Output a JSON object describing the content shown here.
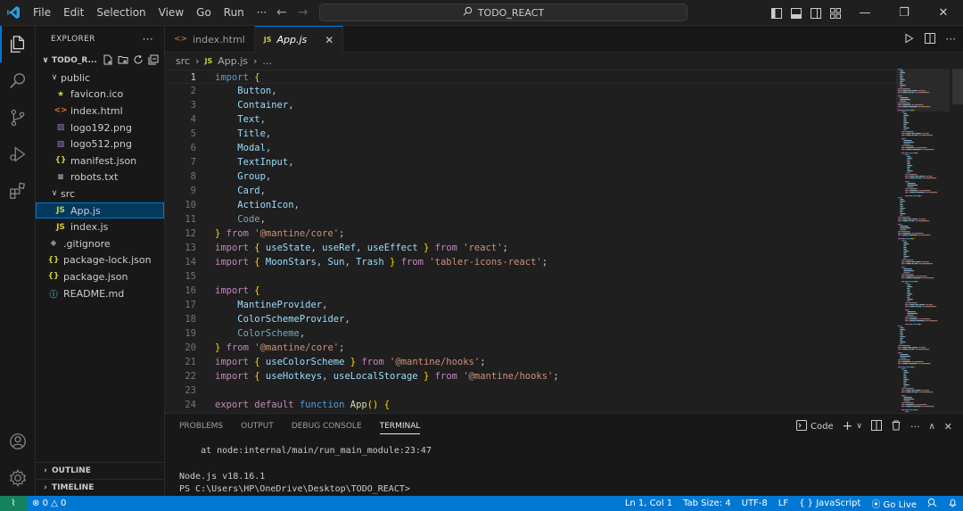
{
  "titlebar": {
    "menu": [
      "File",
      "Edit",
      "Selection",
      "View",
      "Go",
      "Run",
      "···"
    ],
    "search_text": "TODO_REACT",
    "back_arrow": "←",
    "forward_arrow": "→"
  },
  "sidebar": {
    "title": "EXPLORER",
    "more": "···",
    "project": "TODO_R...",
    "tree": [
      {
        "label": "public",
        "type": "folder",
        "depth": 1,
        "chevron": "∨"
      },
      {
        "label": "favicon.ico",
        "type": "star",
        "depth": 2,
        "icon": "★"
      },
      {
        "label": "index.html",
        "type": "html",
        "depth": 2,
        "icon": "<>"
      },
      {
        "label": "logo192.png",
        "type": "image",
        "depth": 2,
        "icon": "▨"
      },
      {
        "label": "logo512.png",
        "type": "image",
        "depth": 2,
        "icon": "▨"
      },
      {
        "label": "manifest.json",
        "type": "json",
        "depth": 2,
        "icon": "{}"
      },
      {
        "label": "robots.txt",
        "type": "text",
        "depth": 2,
        "icon": "≡"
      },
      {
        "label": "src",
        "type": "folder",
        "depth": 1,
        "chevron": "∨"
      },
      {
        "label": "App.js",
        "type": "js",
        "depth": 2,
        "icon": "JS",
        "selected": true
      },
      {
        "label": "index.js",
        "type": "js",
        "depth": 2,
        "icon": "JS"
      },
      {
        "label": ".gitignore",
        "type": "git",
        "depth": 1,
        "icon": "◆"
      },
      {
        "label": "package-lock.json",
        "type": "json",
        "depth": 1,
        "icon": "{}"
      },
      {
        "label": "package.json",
        "type": "json",
        "depth": 1,
        "icon": "{}"
      },
      {
        "label": "README.md",
        "type": "info",
        "depth": 1,
        "icon": "ⓘ"
      }
    ],
    "outline": "OUTLINE",
    "timeline": "TIMELINE"
  },
  "tabs": [
    {
      "label": "index.html",
      "icon": "<>",
      "active": false
    },
    {
      "label": "App.js",
      "icon": "JS",
      "active": true,
      "close": "✕"
    }
  ],
  "breadcrumb": {
    "folder": "src",
    "file_icon": "JS",
    "file": "App.js",
    "sep": "›",
    "more": "..."
  },
  "code_lines": [
    [
      [
        "k",
        "import"
      ],
      [
        "p",
        " "
      ],
      [
        "b",
        "{"
      ]
    ],
    [
      [
        "p",
        "    "
      ],
      [
        "v",
        "Button"
      ],
      [
        "p",
        ","
      ]
    ],
    [
      [
        "p",
        "    "
      ],
      [
        "v",
        "Container"
      ],
      [
        "p",
        ","
      ]
    ],
    [
      [
        "p",
        "    "
      ],
      [
        "v",
        "Text"
      ],
      [
        "p",
        ","
      ]
    ],
    [
      [
        "p",
        "    "
      ],
      [
        "v",
        "Title"
      ],
      [
        "p",
        ","
      ]
    ],
    [
      [
        "p",
        "    "
      ],
      [
        "v",
        "Modal"
      ],
      [
        "p",
        ","
      ]
    ],
    [
      [
        "p",
        "    "
      ],
      [
        "v",
        "TextInput"
      ],
      [
        "p",
        ","
      ]
    ],
    [
      [
        "p",
        "    "
      ],
      [
        "v",
        "Group"
      ],
      [
        "p",
        ","
      ]
    ],
    [
      [
        "p",
        "    "
      ],
      [
        "v",
        "Card"
      ],
      [
        "p",
        ","
      ]
    ],
    [
      [
        "p",
        "    "
      ],
      [
        "v",
        "ActionIcon"
      ],
      [
        "p",
        ","
      ]
    ],
    [
      [
        "p",
        "    "
      ],
      [
        "dim",
        "Code"
      ],
      [
        "p",
        ","
      ]
    ],
    [
      [
        "b",
        "}"
      ],
      [
        "p",
        " "
      ],
      [
        "kp",
        "from"
      ],
      [
        "p",
        " "
      ],
      [
        "s",
        "'@mantine/core'"
      ],
      [
        "p",
        ";"
      ]
    ],
    [
      [
        "kp",
        "import"
      ],
      [
        "p",
        " "
      ],
      [
        "b",
        "{"
      ],
      [
        "p",
        " "
      ],
      [
        "v",
        "useState"
      ],
      [
        "p",
        ", "
      ],
      [
        "v",
        "useRef"
      ],
      [
        "p",
        ", "
      ],
      [
        "v",
        "useEffect"
      ],
      [
        "p",
        " "
      ],
      [
        "b",
        "}"
      ],
      [
        "p",
        " "
      ],
      [
        "kp",
        "from"
      ],
      [
        "p",
        " "
      ],
      [
        "s",
        "'react'"
      ],
      [
        "p",
        ";"
      ]
    ],
    [
      [
        "kp",
        "import"
      ],
      [
        "p",
        " "
      ],
      [
        "b",
        "{"
      ],
      [
        "p",
        " "
      ],
      [
        "v",
        "MoonStars"
      ],
      [
        "p",
        ", "
      ],
      [
        "v",
        "Sun"
      ],
      [
        "p",
        ", "
      ],
      [
        "v",
        "Trash"
      ],
      [
        "p",
        " "
      ],
      [
        "b",
        "}"
      ],
      [
        "p",
        " "
      ],
      [
        "kp",
        "from"
      ],
      [
        "p",
        " "
      ],
      [
        "s",
        "'tabler-icons-react'"
      ],
      [
        "p",
        ";"
      ]
    ],
    [],
    [
      [
        "kp",
        "import"
      ],
      [
        "p",
        " "
      ],
      [
        "b",
        "{"
      ]
    ],
    [
      [
        "p",
        "    "
      ],
      [
        "v",
        "MantineProvider"
      ],
      [
        "p",
        ","
      ]
    ],
    [
      [
        "p",
        "    "
      ],
      [
        "v",
        "ColorSchemeProvider"
      ],
      [
        "p",
        ","
      ]
    ],
    [
      [
        "p",
        "    "
      ],
      [
        "dim",
        "ColorScheme"
      ],
      [
        "p",
        ","
      ]
    ],
    [
      [
        "b",
        "}"
      ],
      [
        "p",
        " "
      ],
      [
        "kp",
        "from"
      ],
      [
        "p",
        " "
      ],
      [
        "s",
        "'@mantine/core'"
      ],
      [
        "p",
        ";"
      ]
    ],
    [
      [
        "kp",
        "import"
      ],
      [
        "p",
        " "
      ],
      [
        "b",
        "{"
      ],
      [
        "p",
        " "
      ],
      [
        "v",
        "useColorScheme"
      ],
      [
        "p",
        " "
      ],
      [
        "b",
        "}"
      ],
      [
        "p",
        " "
      ],
      [
        "kp",
        "from"
      ],
      [
        "p",
        " "
      ],
      [
        "s",
        "'@mantine/hooks'"
      ],
      [
        "p",
        ";"
      ]
    ],
    [
      [
        "kp",
        "import"
      ],
      [
        "p",
        " "
      ],
      [
        "b",
        "{"
      ],
      [
        "p",
        " "
      ],
      [
        "v",
        "useHotkeys"
      ],
      [
        "p",
        ", "
      ],
      [
        "v",
        "useLocalStorage"
      ],
      [
        "p",
        " "
      ],
      [
        "b",
        "}"
      ],
      [
        "p",
        " "
      ],
      [
        "kp",
        "from"
      ],
      [
        "p",
        " "
      ],
      [
        "s",
        "'@mantine/hooks'"
      ],
      [
        "p",
        ";"
      ]
    ],
    [],
    [
      [
        "kp",
        "export"
      ],
      [
        "p",
        " "
      ],
      [
        "kp",
        "default"
      ],
      [
        "p",
        " "
      ],
      [
        "k",
        "function"
      ],
      [
        "p",
        " "
      ],
      [
        "f",
        "App"
      ],
      [
        "b",
        "()"
      ],
      [
        "p",
        " "
      ],
      [
        "b",
        "{"
      ]
    ]
  ],
  "panel": {
    "tabs": [
      "PROBLEMS",
      "OUTPUT",
      "DEBUG CONSOLE",
      "TERMINAL"
    ],
    "active_tab": 3,
    "shell": "Code",
    "terminal_lines": [
      "    at node:internal/main/run_main_module:23:47",
      "",
      "Node.js v18.16.1",
      "PS C:\\Users\\HP\\OneDrive\\Desktop\\TODO_REACT>"
    ]
  },
  "statusbar": {
    "remote_icon": "⌇",
    "errors": "0",
    "warnings": "0",
    "position": "Ln 1, Col 1",
    "tab_size": "Tab Size: 4",
    "encoding": "UTF-8",
    "eol": "LF",
    "language": "JavaScript",
    "live": "Go Live"
  },
  "colors": {
    "accent": "#0078d4",
    "remote": "#16825d",
    "selection": "#04395e"
  }
}
